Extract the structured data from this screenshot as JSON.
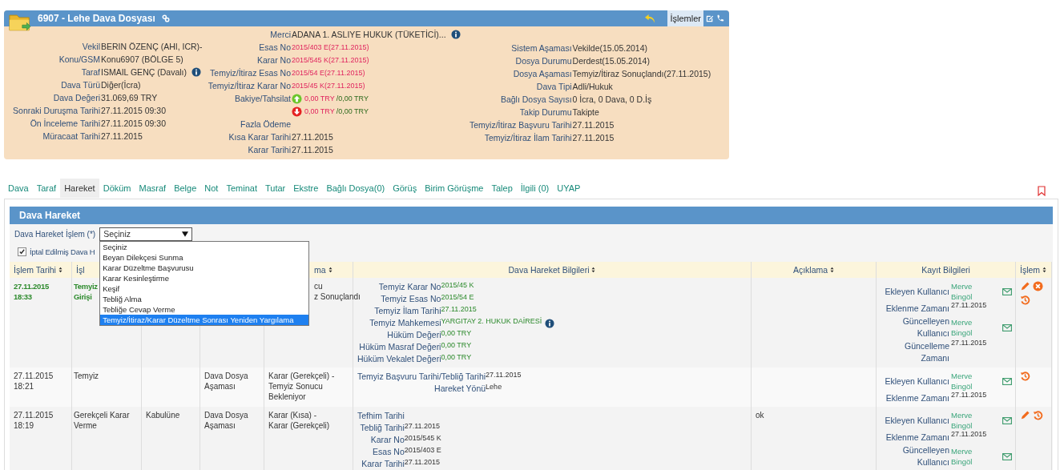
{
  "header": {
    "title": "6907 - Lehe Dava Dosyası",
    "actions_label": "İşlemler",
    "columns": [
      [
        {
          "label": "Vekil",
          "value": "BERIN ÖZENÇ (AHI, ICR)-",
          "kind": "text"
        },
        {
          "label": "Konu/GSM",
          "value": "Konu6907 (BÖLGE 5)",
          "kind": "text"
        },
        {
          "label": "Taraf",
          "value": "ISMAIL GENÇ (Davalı)",
          "kind": "text",
          "info": true
        },
        {
          "label": "Dava Türü",
          "value": "Diğer(İcra)",
          "kind": "text"
        },
        {
          "label": "Dava Değeri",
          "value": "31.069,69 TRY",
          "kind": "text"
        },
        {
          "label": "Sonraki Duruşma Tarihi",
          "value": "27.11.2015 09:30",
          "kind": "text"
        },
        {
          "label": "Ön İnceleme Tarihi",
          "value": "27.11.2015 09:30",
          "kind": "text"
        },
        {
          "label": "Müracaat Tarihi",
          "value": "27.11.2015",
          "kind": "text"
        }
      ],
      [
        {
          "label": "Merci",
          "value": "ADANA 1. ASLIYE HUKUK (TÜKETİCİ)...",
          "kind": "text",
          "info": true
        },
        {
          "label": "Esas No",
          "value": "2015/403 E(27.11.2015)",
          "kind": "code"
        },
        {
          "label": "Karar No",
          "value": "2015/545 K(27.11.2015)",
          "kind": "code"
        },
        {
          "label": "Temyiz/İtiraz Esas No",
          "value": "2015/54 E(27.11.2015)",
          "kind": "code"
        },
        {
          "label": "Temyiz/İtiraz Karar No",
          "value": "2015/45 K(27.11.2015)",
          "kind": "code"
        },
        {
          "label": "Bakiye/Tahsilat",
          "value": "0,00 TRY",
          "value2": "/0,00 TRY",
          "kind": "up"
        },
        {
          "value": "0,00 TRY",
          "value2": "/0,00 TRY",
          "kind": "down"
        },
        {
          "label": "Fazla Ödeme",
          "kind": "text"
        },
        {
          "label": "Kısa Karar Tarihi",
          "value": "27.11.2015",
          "kind": "text"
        },
        {
          "label": "Karar Tarihi",
          "value": "27.11.2015",
          "kind": "text"
        }
      ],
      [
        {
          "label": "Sistem Aşaması",
          "value": "Vekilde(15.05.2014)",
          "kind": "text"
        },
        {
          "label": "Dosya Durumu",
          "value": "Derdest(15.05.2014)",
          "kind": "text"
        },
        {
          "label": "Dosya Aşaması",
          "value": "Temyiz/İtiraz Sonuçlandı(27.11.2015)",
          "kind": "text"
        },
        {
          "label": "Dava Tipi",
          "value": "Adli/Hukuk",
          "kind": "text"
        },
        {
          "label": "Bağlı Dosya Sayısı",
          "value": "0 İcra, 0 Dava, 0 D.İş",
          "kind": "text"
        },
        {
          "label": "Takip Durumu",
          "value": "Takipte",
          "kind": "text"
        },
        {
          "label": "Temyiz/İtiraz Başvuru Tarihi",
          "value": "27.11.2015",
          "kind": "text"
        },
        {
          "label": "Temyiz/İtiraz İlam Tarihi",
          "value": "27.11.2015",
          "kind": "text"
        }
      ]
    ]
  },
  "tabs": [
    {
      "label": "Dava",
      "selected": false
    },
    {
      "label": "Taraf",
      "selected": false
    },
    {
      "label": "Hareket",
      "selected": true
    },
    {
      "label": "Döküm",
      "selected": false
    },
    {
      "label": "Masraf",
      "selected": false
    },
    {
      "label": "Belge",
      "selected": false
    },
    {
      "label": "Not",
      "selected": false
    },
    {
      "label": "Teminat",
      "selected": false
    },
    {
      "label": "Tutar",
      "selected": false
    },
    {
      "label": "Ekstre",
      "selected": false
    },
    {
      "label": "Bağlı Dosya(0)",
      "selected": false
    },
    {
      "label": "Görüş",
      "selected": false
    },
    {
      "label": "Birim Görüşme",
      "selected": false
    },
    {
      "label": "Talep",
      "selected": false
    },
    {
      "label": "İlgili (0)",
      "selected": false
    },
    {
      "label": "UYAP",
      "selected": false
    }
  ],
  "panel": {
    "title": "Dava Hareket",
    "select_label": "Dava Hareket İşlem (*)",
    "select_value": "Seçiniz",
    "options": [
      {
        "label": "Seçiniz",
        "selected": false
      },
      {
        "label": "Beyan Dilekçesi Sunma",
        "selected": false
      },
      {
        "label": "Karar Düzeltme Başvurusu",
        "selected": false
      },
      {
        "label": "Karar Kesinleştirme",
        "selected": false
      },
      {
        "label": "Keşif",
        "selected": false
      },
      {
        "label": "Tebliğ Alma",
        "selected": false
      },
      {
        "label": "Tebliğe Cevap Verme",
        "selected": false
      },
      {
        "label": "Temyiz/İtiraz/Karar Düzeltme Sonrası Yeniden Yargılama",
        "selected": true
      }
    ],
    "checkbox": {
      "label": "İptal Edilmiş Dava H",
      "checked": true
    }
  },
  "table": {
    "columns": [
      {
        "label": "İşlem Tarihi",
        "sortable": true
      },
      {
        "label": "İşl"
      },
      null,
      null,
      {
        "label": "ma",
        "sortable": true
      },
      {
        "label": "Dava Hareket Bilgileri",
        "sortable": true
      },
      {
        "label": "Açıklama",
        "sortable": true
      },
      {
        "label": "Kayıt Bilgileri",
        "sortable": false
      },
      {
        "label": "İşlem",
        "sortable": true
      }
    ],
    "rows": [
      {
        "highlighted": true,
        "cells": [
          "27.11.2015\n18:33",
          "Temyiz\nGirişi",
          "",
          "",
          "cu\nz Sonuçlandı"
        ],
        "info": [
          {
            "label": "Temyiz Karar No",
            "value": "2015/45 K"
          },
          {
            "label": "Temyiz Esas No",
            "value": "2015/54 E"
          },
          {
            "label": "Temyiz İlam Tarihi",
            "value": "27.11.2015"
          },
          {
            "label": "Temyiz Mahkemesi",
            "value": "YARGITAY 2. HUKUK DAİRESİ",
            "info": true
          },
          {
            "label": "Hüküm Değeri",
            "value": "0,00 TRY"
          },
          {
            "label": "Hüküm Masraf Değeri",
            "value": "0,00 TRY"
          },
          {
            "label": "Hüküm Vekalet Değeri",
            "value": "0,00 TRY"
          }
        ],
        "note": "",
        "record": [
          {
            "label": "Ekleyen Kullanıcı",
            "value": "Merve Bingöl",
            "kind": "user"
          },
          {
            "label": "Eklenme Zamanı",
            "value": "27.11.2015",
            "kind": "time"
          },
          {
            "label": "Güncelleyen Kullanıcı",
            "value": "Merve Bingöl",
            "kind": "user"
          },
          {
            "label": "Güncelleme Zamanı",
            "value": "27.11.2015",
            "kind": "time"
          }
        ],
        "actions": [
          {
            "kind": "edit"
          },
          {
            "kind": "delete"
          },
          {
            "kind": "history"
          }
        ]
      },
      {
        "highlighted": false,
        "cells": [
          "27.11.2015\n18:21",
          "Temyiz",
          "",
          "Dava Dosya\nAşaması",
          "Karar (Gerekçeli) -\nTemyiz Sonucu\nBekleniyor"
        ],
        "info": [
          {
            "label": "Temyiz Başvuru Tarihi/Tebliğ Tarihi",
            "value": "27.11.2015"
          },
          {
            "label": "Hareket Yönü",
            "value": "Lehe"
          }
        ],
        "note": "",
        "record": [
          {
            "label": "Ekleyen Kullanıcı",
            "value": "Merve Bingöl",
            "kind": "user"
          },
          {
            "label": "Eklenme Zamanı",
            "value": "27.11.2015",
            "kind": "time"
          }
        ],
        "actions": [
          {
            "kind": "history"
          }
        ]
      },
      {
        "highlighted": false,
        "cells": [
          "27.11.2015\n18:19",
          "Gerekçeli Karar\nVerme",
          "Kabulüne",
          "Dava Dosya\nAşaması",
          "Karar (Kısa) -\nKarar (Gerekçeli)"
        ],
        "info": [
          {
            "label": "Tefhim Tarihi"
          },
          {
            "label": "Tebliğ Tarihi",
            "value": "27.11.2015"
          },
          {
            "label": "Karar No",
            "value": "2015/545 K"
          },
          {
            "label": "Esas No",
            "value": "2015/403 E"
          },
          {
            "label": "Karar Tarihi",
            "value": "27.11.2015"
          }
        ],
        "note": "ok",
        "record": [
          {
            "label": "Ekleyen Kullanıcı",
            "value": "Merve Bingöl",
            "kind": "user"
          },
          {
            "label": "Eklenme Zamanı",
            "value": "27.11.2015",
            "kind": "time"
          },
          {
            "label": "Güncelleyen Kullanıcı",
            "value": "Merve Bingöl",
            "kind": "user"
          }
        ],
        "actions": [
          {
            "kind": "edit"
          },
          {
            "kind": "history"
          }
        ]
      }
    ]
  }
}
